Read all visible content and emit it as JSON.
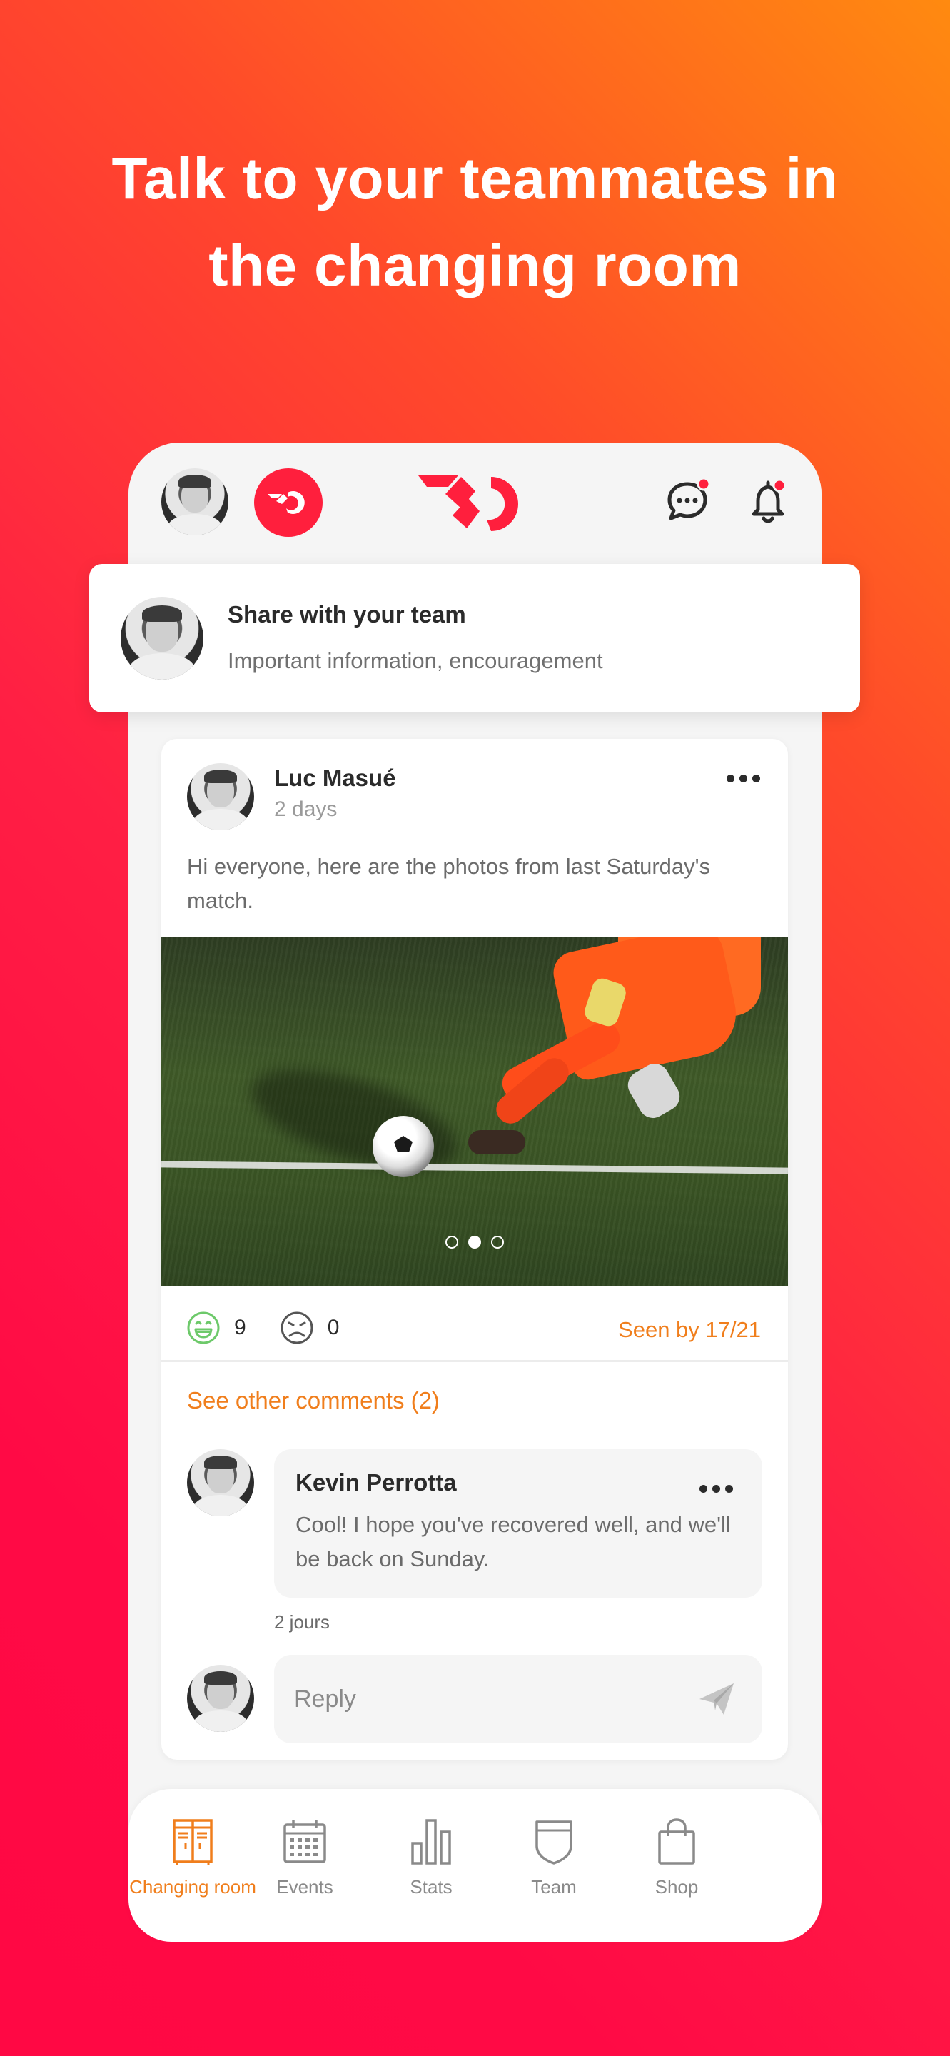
{
  "headline": {
    "line1": "Talk to your teammates in",
    "line2": "the changing room"
  },
  "header": {
    "user_avatar": "user-avatar",
    "brand_icon": "brand-circle-icon",
    "logo": "TD-logo",
    "icons": [
      "chat-icon",
      "bell-icon"
    ],
    "notification_color": "#ff1f3d"
  },
  "share": {
    "title": "Share with your team",
    "subtitle": "Important information, encouragement"
  },
  "post": {
    "author": "Luc Masué",
    "time": "2 days",
    "text": "Hi everyone, here are the photos from last Saturday's match.",
    "carousel": {
      "total": 3,
      "active_index": 1
    },
    "reactions": {
      "happy_icon": "happy-face-icon",
      "happy_count": "9",
      "sad_icon": "sad-face-icon",
      "sad_count": "0"
    },
    "seen": "Seen by 17/21",
    "see_comments": "See other comments (2)"
  },
  "comment": {
    "author": "Kevin Perrotta",
    "text": "Cool! I hope you've recovered well, and we'll be back on Sunday.",
    "time": "2 jours"
  },
  "reply": {
    "placeholder": "Reply",
    "send_icon": "send-icon"
  },
  "tabbar": {
    "active": 0,
    "items": [
      {
        "label": "Changing room",
        "icon": "locker-icon"
      },
      {
        "label": "Events",
        "icon": "calendar-icon"
      },
      {
        "label": "Stats",
        "icon": "bar-chart-icon"
      },
      {
        "label": "Team",
        "icon": "shield-icon"
      },
      {
        "label": "Shop",
        "icon": "shopping-bag-icon"
      }
    ]
  },
  "colors": {
    "accent_orange": "#f07e1c",
    "brand_red": "#ff1f3d",
    "happy_green": "#6dc96a",
    "background_gradient_start": "#ff8a10",
    "background_gradient_end": "#ff0844"
  }
}
